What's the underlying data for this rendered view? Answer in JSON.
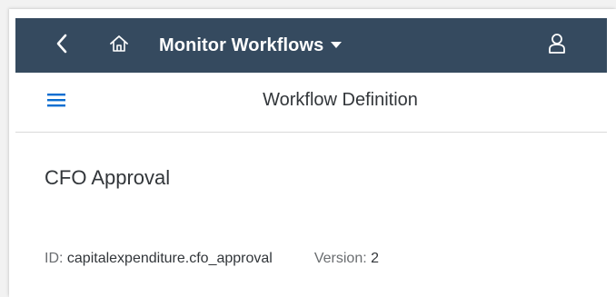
{
  "shellbar": {
    "title": "Monitor Workflows",
    "background_color": "#354a5f",
    "icons": {
      "back": "chevron-left-icon",
      "home": "home-icon",
      "dropdown": "caret-down-icon",
      "user": "user-icon"
    }
  },
  "subheader": {
    "title": "Workflow Definition",
    "menu_icon": "hamburger-menu-icon",
    "menu_color": "#0a6ed1"
  },
  "object": {
    "title": "CFO Approval",
    "id_label": "ID:",
    "id_value": "capitalexpenditure.cfo_approval",
    "version_label": "Version:",
    "version_value": "2"
  }
}
